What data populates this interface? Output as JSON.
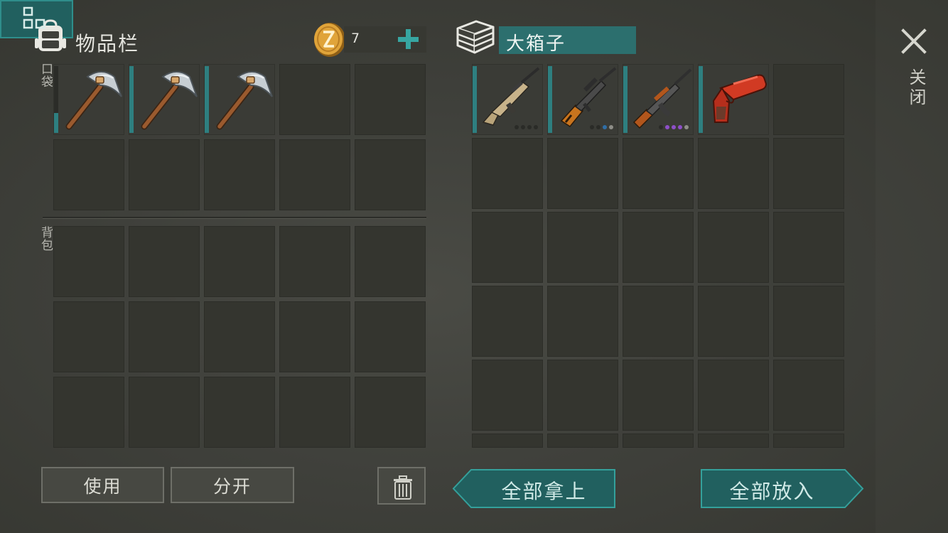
{
  "inventory": {
    "title": "物品栏",
    "pocket_label": "口袋",
    "bag_label": "背包",
    "coins": "7",
    "pocket_slots": [
      {
        "item": "pickaxe",
        "durability": 0.3
      },
      {
        "item": "pickaxe",
        "durability": 1.0
      },
      {
        "item": "pickaxe",
        "durability": 1.0
      },
      null,
      null,
      null,
      null,
      null,
      null,
      null
    ],
    "bag_rows": 3,
    "bag_cols": 5
  },
  "chest": {
    "title": "大箱子",
    "slots": [
      {
        "item": "scar-rifle",
        "durability": 1.0,
        "dots": [
          "#2a2b27",
          "#2a2b27",
          "#2a2b27",
          "#2a2b27"
        ]
      },
      {
        "item": "sniper-rifle",
        "durability": 1.0,
        "dots": [
          "#2a2b27",
          "#2a2b27",
          "#2f6ea6",
          "#8e8e88"
        ]
      },
      {
        "item": "ak-rifle",
        "durability": 1.0,
        "dots": [
          "#2a2b27",
          "#8e4fc9",
          "#8e4fc9",
          "#8e4fc9",
          "#8e8e88"
        ]
      },
      {
        "item": "flare-gun",
        "durability": 1.0,
        "dots": []
      },
      null
    ],
    "rows": 5,
    "cols": 5
  },
  "close_label": "关闭",
  "buttons": {
    "use": "使用",
    "split": "分开",
    "take_all": "全部拿上",
    "put_all": "全部放入"
  },
  "colors": {
    "accent_teal": "#2c6f6e",
    "durability": "#2e7f80",
    "coin": "#d9a23a"
  }
}
